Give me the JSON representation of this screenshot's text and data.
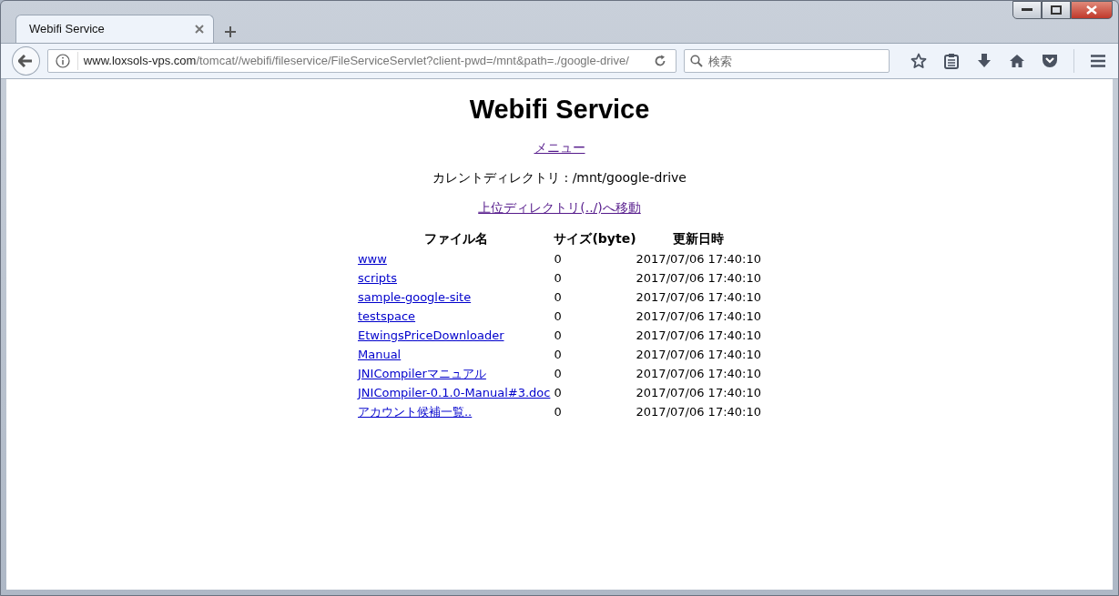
{
  "browser": {
    "tabs": [
      {
        "title": "Webifi Service",
        "selected": true
      }
    ],
    "address": {
      "host": "www.loxsols-vps.com",
      "path": "/tomcat//webifi/fileservice/FileServiceServlet?client-pwd=/mnt&path=./google-drive/"
    },
    "search": {
      "placeholder": "検索"
    }
  },
  "page": {
    "title": "Webifi Service",
    "menu_link": {
      "text": "メニュー",
      "visited": true
    },
    "current_dir": "カレントディレクトリ : /mnt/google-drive",
    "parent_link": {
      "text": "上位ディレクトリ(../)へ移動",
      "visited": true
    },
    "table": {
      "columns": [
        "ファイル名",
        "サイズ(byte)",
        "更新日時"
      ],
      "rows": [
        {
          "name": "www",
          "visited": false,
          "size": "0",
          "modified": "2017/07/06 17:40:10"
        },
        {
          "name": "scripts",
          "visited": false,
          "size": "0",
          "modified": "2017/07/06 17:40:10"
        },
        {
          "name": "sample-google-site",
          "visited": false,
          "size": "0",
          "modified": "2017/07/06 17:40:10"
        },
        {
          "name": "testspace",
          "visited": false,
          "size": "0",
          "modified": "2017/07/06 17:40:10"
        },
        {
          "name": "EtwingsPriceDownloader",
          "visited": false,
          "size": "0",
          "modified": "2017/07/06 17:40:10"
        },
        {
          "name": "Manual",
          "visited": false,
          "size": "0",
          "modified": "2017/07/06 17:40:10"
        },
        {
          "name": "JNICompilerマニュアル",
          "visited": false,
          "size": "0",
          "modified": "2017/07/06 17:40:10"
        },
        {
          "name": "JNICompiler-0.1.0-Manual#3.doc",
          "visited": false,
          "size": "0",
          "modified": "2017/07/06 17:40:10"
        },
        {
          "name": "アカウント候補一覧..",
          "visited": false,
          "size": "0",
          "modified": "2017/07/06 17:40:10"
        }
      ]
    }
  }
}
